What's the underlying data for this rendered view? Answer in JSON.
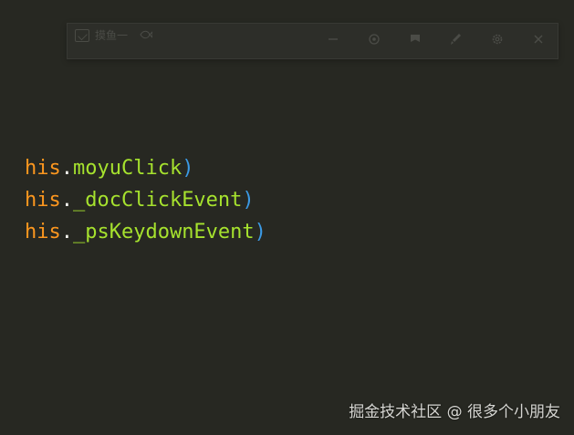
{
  "toolbar": {
    "title": "摸鱼一",
    "buttons": [
      {
        "icon": "minimize-icon"
      },
      {
        "icon": "record-icon"
      },
      {
        "icon": "flag-icon"
      },
      {
        "icon": "brush-icon"
      },
      {
        "icon": "settings-icon"
      },
      {
        "icon": "close-icon"
      }
    ]
  },
  "code": {
    "lines": [
      {
        "this": "his",
        "dot": ".",
        "fn": "moyuClick",
        "paren": ")"
      },
      {
        "this": "his",
        "dot": ".",
        "fn": "_docClickEvent",
        "paren": ")"
      },
      {
        "this": "his",
        "dot": ".",
        "fn": "_psKeydownEvent",
        "paren": ")"
      }
    ]
  },
  "watermark": "掘金技术社区 @ 很多个小朋友",
  "colors": {
    "background": "#272822",
    "keyword_this": "#fd971f",
    "function": "#a6e22e",
    "paren": "#3b9ae5",
    "toolbar_bg": "#2d2e29",
    "toolbar_icon": "#4b4c47"
  }
}
